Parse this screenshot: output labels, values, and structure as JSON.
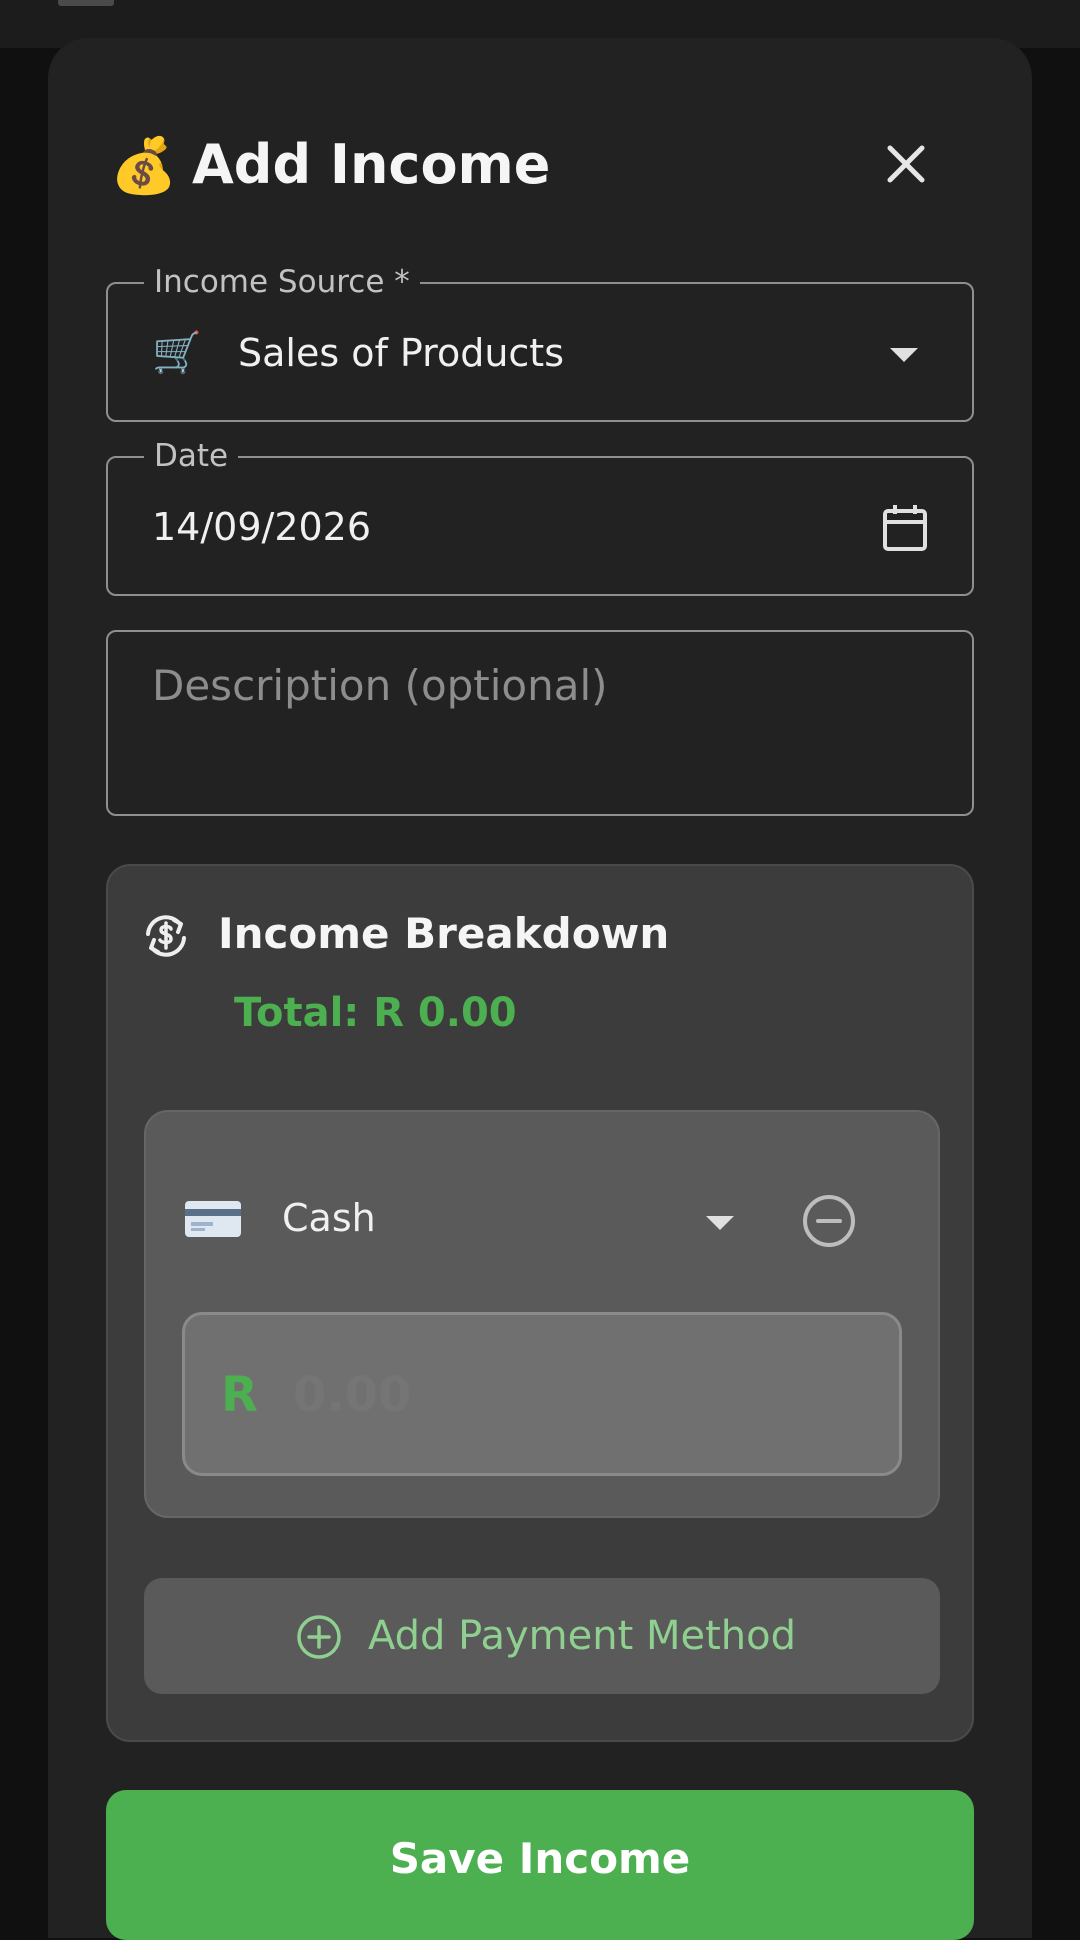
{
  "dialog": {
    "header_icon": "💰",
    "title": "Add Income",
    "close_icon": "close-icon"
  },
  "income_source": {
    "label": "Income Source *",
    "icon": "🛒",
    "value": "Sales of Products"
  },
  "date": {
    "label": "Date",
    "value": "14/09/2026",
    "icon": "calendar-icon"
  },
  "description": {
    "placeholder": "Description (optional)",
    "value": ""
  },
  "breakdown": {
    "title": "Income Breakdown",
    "icon": "currency-exchange-icon",
    "total": "Total: R 0.00",
    "methods": [
      {
        "icon": "credit-card-icon",
        "name": "Cash",
        "currency": "R",
        "amount": "0.00"
      }
    ],
    "add_label": "Add Payment Method"
  },
  "save_label": "Save Income",
  "colors": {
    "accent": "#4caf50",
    "background": "#222222",
    "panel": "#3c3c3c",
    "card": "#5a5a5a"
  }
}
